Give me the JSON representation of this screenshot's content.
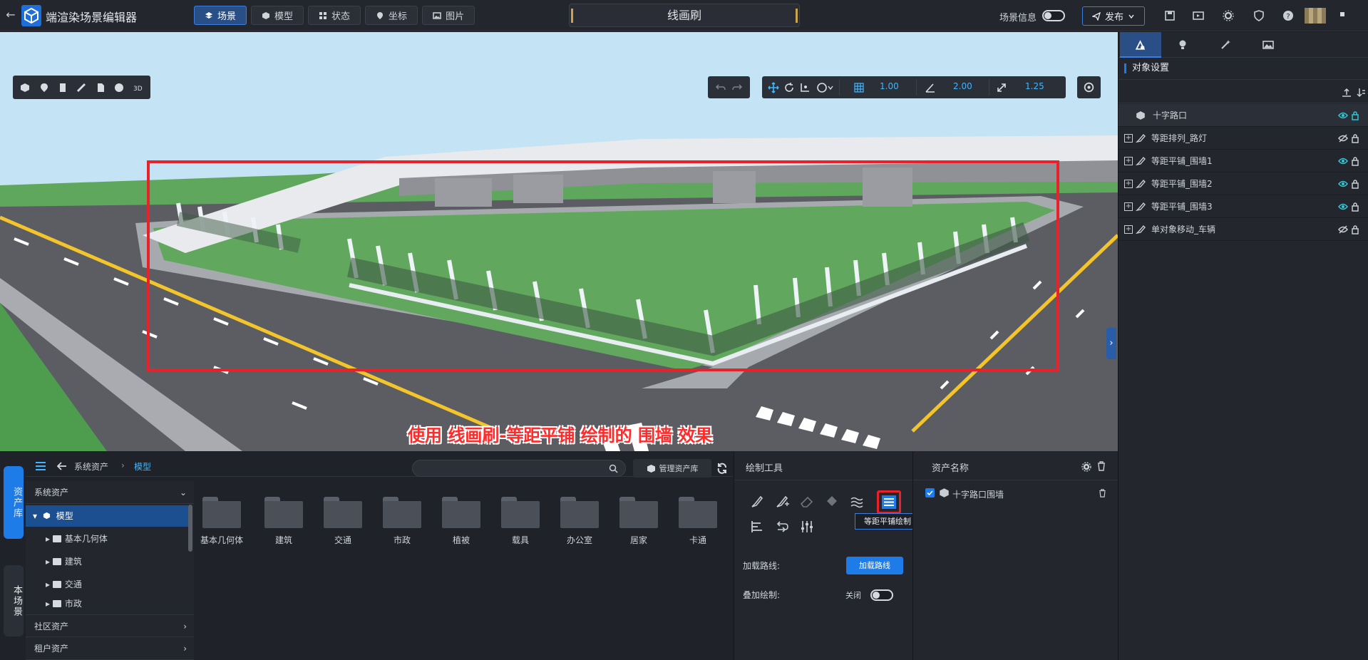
{
  "app": {
    "title": "端渲染场景编辑器"
  },
  "nav": {
    "tabs": [
      {
        "label": "场景"
      },
      {
        "label": "模型"
      },
      {
        "label": "状态"
      },
      {
        "label": "坐标"
      },
      {
        "label": "图片"
      }
    ]
  },
  "brush": {
    "title": "线画刷"
  },
  "header": {
    "scene_info": "场景信息",
    "publish": "发布"
  },
  "transform": {
    "grid": "1.00",
    "angle": "2.00",
    "scale": "1.25"
  },
  "viewport": {
    "caption": "使用 线画刷-等距平铺 绘制的 围墙 效果"
  },
  "assets": {
    "side_tabs": [
      "资产库",
      "本场景"
    ],
    "breadcrumb": [
      "系统资产",
      "模型"
    ],
    "search_placeholder": "",
    "manage_label": "管理资产库",
    "sections": [
      "系统资产",
      "社区资产",
      "租户资产"
    ],
    "tree": [
      "模型",
      "基本几何体",
      "建筑",
      "交通",
      "市政"
    ],
    "folders": [
      "基本几何体",
      "建筑",
      "交通",
      "市政",
      "植被",
      "载具",
      "办公室",
      "居家",
      "卡通"
    ]
  },
  "draw_tools": {
    "title": "绘制工具",
    "tooltip": "等距平铺绘制",
    "load_path_label": "加载路线:",
    "load_path_button": "加载路线",
    "overlay_label": "叠加绘制:",
    "overlay_state": "关闭"
  },
  "asset_name": {
    "title": "资产名称",
    "item": "十字路口围墙"
  },
  "right_panel": {
    "section_title": "对象设置",
    "objects": [
      {
        "name": "十字路口",
        "visible": true
      },
      {
        "name": "等距排列_路灯",
        "visible": false
      },
      {
        "name": "等距平铺_围墙1",
        "visible": true
      },
      {
        "name": "等距平铺_围墙2",
        "visible": true
      },
      {
        "name": "等距平铺_围墙3",
        "visible": true
      },
      {
        "name": "单对象移动_车辆",
        "visible": false
      }
    ]
  },
  "colors": {
    "accent": "#1e7ce8",
    "highlight_red": "#e8222a",
    "value_blue": "#3fb6ff"
  }
}
